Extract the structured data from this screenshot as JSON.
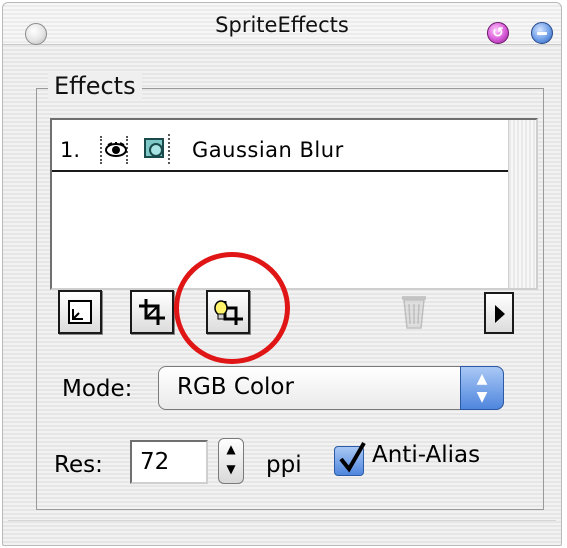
{
  "window": {
    "title": "SpriteEffects"
  },
  "effects": {
    "group_label": "Effects",
    "rows": [
      {
        "index": "1.",
        "name": "Gaussian Blur"
      }
    ]
  },
  "toolbar": {
    "icons": [
      "new-effect-icon",
      "crop-icon",
      "bulb-crop-icon",
      "trash-icon",
      "arrow-right-icon"
    ]
  },
  "mode": {
    "label": "Mode:",
    "value": "RGB Color"
  },
  "resolution": {
    "label": "Res:",
    "value": "72",
    "unit": "ppi"
  },
  "antialias": {
    "label": "Anti-Alias",
    "checked": true
  },
  "colors": {
    "highlight": "#e01515",
    "accent": "#4f86dd"
  }
}
